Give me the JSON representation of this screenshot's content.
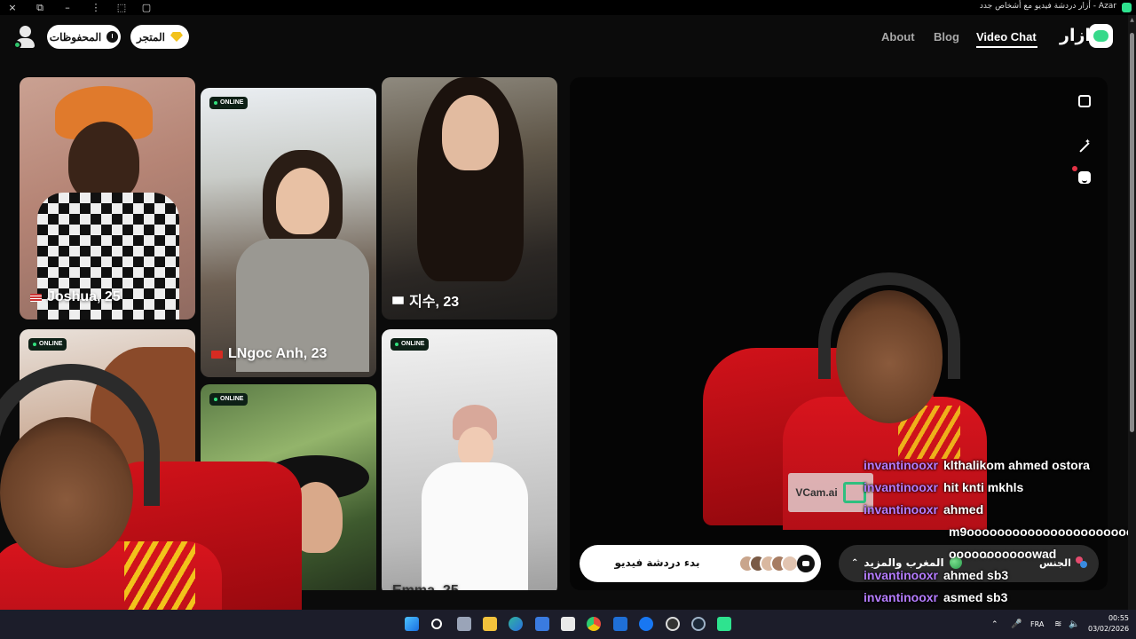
{
  "window": {
    "title": "Azar - أزار دردشة فيديو مع أشخاص جدد",
    "controls": [
      "×",
      "⧉",
      "–",
      "⋮",
      "⬚",
      "▢"
    ]
  },
  "header": {
    "saved_label": "المحفوظات",
    "shop_label": "المتجر",
    "nav": {
      "about": "About",
      "blog": "Blog",
      "video_chat": "Video Chat"
    },
    "brand": "ازار"
  },
  "cards": [
    {
      "name": "Joshua, 25",
      "flag": "us",
      "online": false
    },
    {
      "name": "LNgoc Anh, 23",
      "flag": "vn",
      "online": true
    },
    {
      "name": "지수, 23",
      "flag": "kr",
      "online": true
    },
    {
      "name": "",
      "flag": "",
      "online": true
    },
    {
      "name": "",
      "flag": "",
      "online": true
    },
    {
      "name": "Emma, 25",
      "flag": "",
      "online": true
    }
  ],
  "online_label": "ONLINE",
  "card_labels": {
    "joshua": "Joshua, 25",
    "ngoc": "LNgoc Anh, 23",
    "jisu": "지수, 23",
    "emma": "Emma, 25"
  },
  "video": {
    "watermark": "VCam.ai",
    "start_label": "بدء دردشة فيديو",
    "country_filter": "المغرب والمزيد",
    "gender_filter": "الجنس"
  },
  "chat": [
    {
      "user": "invantinooxr",
      "message": "klthalikom ahmed ostora"
    },
    {
      "user": "invantinooxr",
      "message": "hit knti mkhls"
    },
    {
      "user": "invantinooxr",
      "message": "ahmed"
    },
    {
      "user": "",
      "message": "m9oooooooooooooooooooooo"
    },
    {
      "user": "",
      "message": "ooooooooooowad"
    },
    {
      "user": "invantinooxr",
      "message": "ahmed sb3"
    },
    {
      "user": "invantinooxr",
      "message": "asmed sb3"
    }
  ],
  "taskbar": {
    "language": "FRA",
    "time": "00:55",
    "date": "03/02/2026"
  },
  "colors": {
    "accent": "#2ee38f",
    "chat_user": "#b57cff",
    "online_dot": "#31e07d",
    "filter_bg": "#2b2b2b"
  }
}
